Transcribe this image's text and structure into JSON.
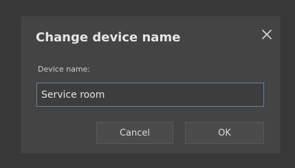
{
  "dialog": {
    "title": "Change device name",
    "close_icon": "close-icon",
    "field_label": "Device name:",
    "field_value": "Service room",
    "cancel_label": "Cancel",
    "ok_label": "OK"
  },
  "colors": {
    "background": "#383838",
    "dialog_background": "#444444",
    "input_border_focus": "#5c84b4",
    "text": "#e6e6e6"
  }
}
